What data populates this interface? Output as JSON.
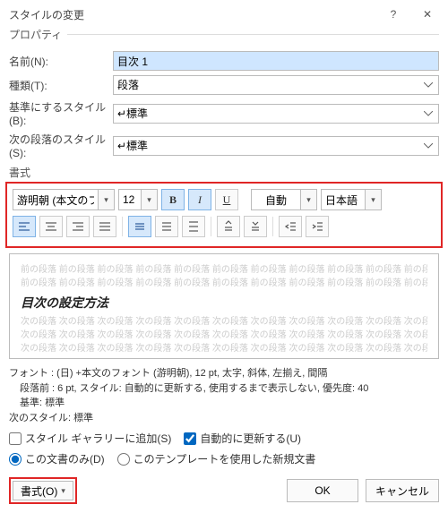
{
  "title": "スタイルの変更",
  "props_legend": "プロパティ",
  "labels": {
    "name": "名前(N):",
    "type": "種類(T):",
    "based_on": "基準にするスタイル(B):",
    "next_style": "次の段落のスタイル(S):"
  },
  "values": {
    "name": "目次 1",
    "type": "段落",
    "based_on": "↵標準",
    "next_style": "↵標準"
  },
  "format_legend": "書式",
  "toolbar": {
    "font": "游明朝 (本文のフ",
    "size": "12",
    "bold": "B",
    "italic": "I",
    "underline": "U",
    "color": "自動",
    "lang": "日本語"
  },
  "preview": {
    "ghost_before": "前の段落 前の段落 前の段落 前の段落 前の段落 前の段落 前の段落 前の段落 前の段落 前の段落 前の段落 前の段落 前の段落 前の段落 前の段落 前の段落 前の段落 前の段落 前の段落 前の段落",
    "heading": "目次の設定方法",
    "ghost_after": "次の段落 次の段落 次の段落 次の段落 次の段落 次の段落 次の段落 次の段落 次の段落 次の段落 次の段落 次の段落 次の段落 次の段落 次の段落 次の段落 次の段落 次の段落 次の段落 次の段落 次の段落 次の段落 次の段落 次の段落 次の段落 次の段落 次の段落 次の段落"
  },
  "desc": {
    "line1": "フォント : (日) +本文のフォント (游明朝), 12 pt, 太字, 斜体, 左揃え, 間隔",
    "line2": "段落前 :  6 pt, スタイル: 自動的に更新する, 使用するまで表示しない, 優先度: 40",
    "line3": "基準: 標準",
    "line4": "次のスタイル: 標準"
  },
  "checks": {
    "gallery": "スタイル ギャラリーに追加(S)",
    "auto_update": "自動的に更新する(U)"
  },
  "radios": {
    "this_doc": "この文書のみ(D)",
    "template": "このテンプレートを使用した新規文書"
  },
  "footer": {
    "format_btn": "書式(O)",
    "ok": "OK",
    "cancel": "キャンセル"
  }
}
